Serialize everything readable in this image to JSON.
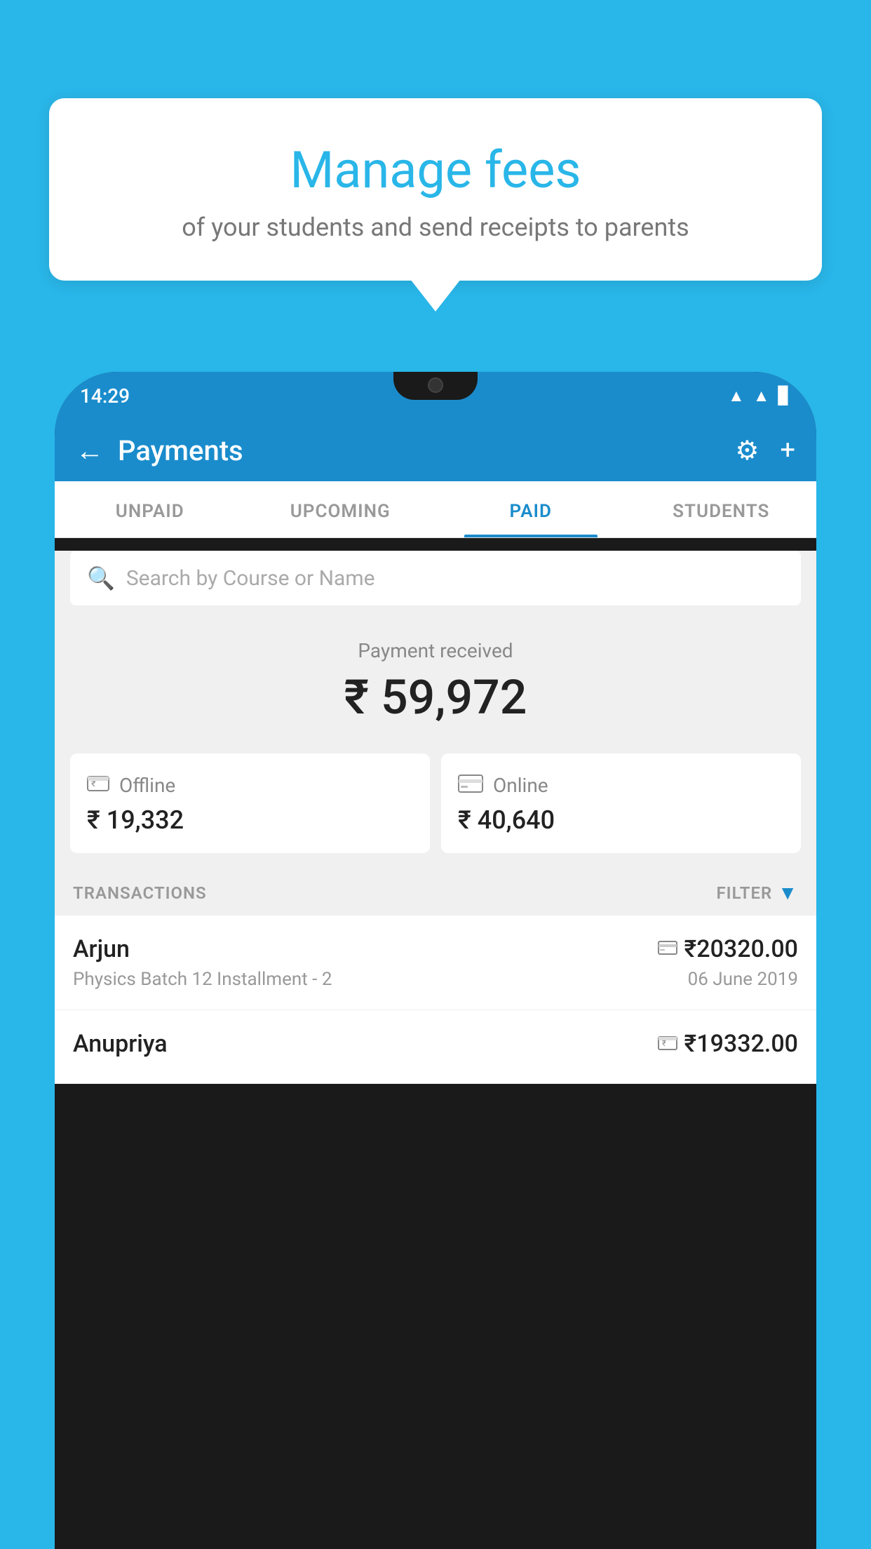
{
  "background_color": "#29b6e8",
  "tooltip": {
    "title": "Manage fees",
    "subtitle": "of your students and send receipts to parents"
  },
  "phone": {
    "status_bar": {
      "time": "14:29",
      "icons": [
        "wifi",
        "signal",
        "battery"
      ]
    },
    "header": {
      "back_label": "←",
      "title": "Payments",
      "gear_icon": "⚙",
      "plus_icon": "+"
    },
    "tabs": [
      {
        "label": "UNPAID",
        "active": false
      },
      {
        "label": "UPCOMING",
        "active": false
      },
      {
        "label": "PAID",
        "active": true
      },
      {
        "label": "STUDENTS",
        "active": false
      }
    ],
    "search": {
      "placeholder": "Search by Course or Name"
    },
    "payment_summary": {
      "label": "Payment received",
      "amount": "₹ 59,972",
      "cards": [
        {
          "type": "offline",
          "label": "Offline",
          "amount": "₹ 19,332"
        },
        {
          "type": "online",
          "label": "Online",
          "amount": "₹ 40,640"
        }
      ]
    },
    "transactions_section": {
      "header_label": "TRANSACTIONS",
      "filter_label": "FILTER",
      "items": [
        {
          "name": "Arjun",
          "course": "Physics Batch 12 Installment - 2",
          "amount": "₹20320.00",
          "date": "06 June 2019",
          "payment_type": "online"
        },
        {
          "name": "Anupriya",
          "course": "",
          "amount": "₹19332.00",
          "date": "",
          "payment_type": "offline"
        }
      ]
    }
  }
}
